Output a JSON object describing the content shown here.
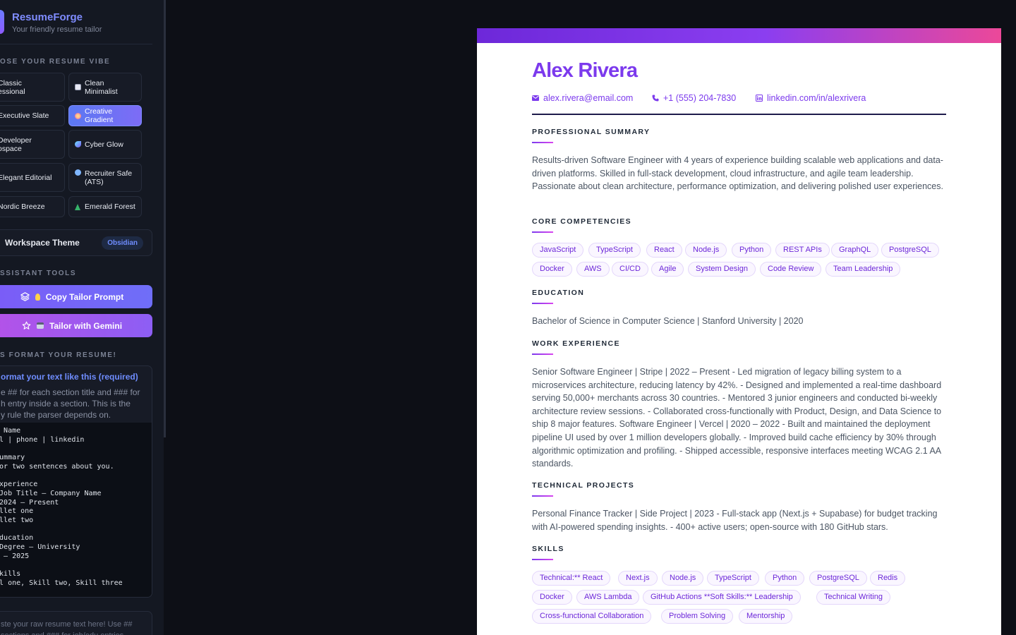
{
  "app": {
    "name": "ResumeForge",
    "tagline": "Your friendly resume tailor"
  },
  "sidebar": {
    "vibe_section": "OSE YOUR RESUME VIBE",
    "vibes": [
      {
        "label": "Classic\nessional",
        "icon": "none",
        "active": false
      },
      {
        "label": "Clean Minimalist",
        "icon": "square-icon",
        "active": false
      },
      {
        "label": "Executive Slate",
        "icon": "none",
        "active": false
      },
      {
        "label": "Creative Gradient",
        "icon": "palette-icon",
        "active": true
      },
      {
        "label": "Developer\nospace",
        "icon": "none",
        "active": false
      },
      {
        "label": "Cyber Glow",
        "icon": "comet-icon",
        "active": false
      },
      {
        "label": "Elegant Editorial",
        "icon": "none",
        "active": false
      },
      {
        "label": "Recruiter Safe\n(ATS)",
        "icon": "magnifier-icon",
        "active": false
      },
      {
        "label": "Nordic Breeze",
        "icon": "none",
        "active": false
      },
      {
        "label": "Emerald Forest",
        "icon": "tree-icon",
        "active": false
      }
    ],
    "theme": {
      "label": "Workspace Theme",
      "value": "Obsidian"
    },
    "tools_section": "SSISTANT TOOLS",
    "tools": {
      "copy_prompt": "Copy Tailor Prompt",
      "copy_prompt_icons": "layers-icon lightbulb-icon",
      "gemini": "Tailor with Gemini",
      "gemini_icons": "star-icon robot-icon"
    },
    "format_section": "S FORMAT YOUR RESUME!",
    "format": {
      "title": "ormat your text like this (required)",
      "description": "e ## for each section title and ### for\nh entry inside a section. This is the\ny rule the parser depends on.",
      "code": "ur Name\nail | phone | linkedin\n\n Summary\ne or two sentences about you.\n\n Experience\n# Job Title — Company Name\nn 2024 – Present\nBullet one\nBullet two\n\n Education\n# Degree — University\n21 – 2025\n\n Skills\nill one, Skill two, Skill three"
    },
    "paste_placeholder": "ste your raw resume text here! Use ##\nsections and ### for job/edu entries"
  },
  "resume": {
    "name": "Alex Rivera",
    "email": "alex.rivera@email.com",
    "phone": "+1 (555) 204-7830",
    "linkedin": "linkedin.com/in/alexrivera",
    "sections": {
      "summary_title": "PROFESSIONAL SUMMARY",
      "summary": "Results-driven Software Engineer with 4 years of experience building scalable web applications and data-driven platforms. Skilled in full-stack development, cloud infrastructure, and agile team leadership. Passionate about clean architecture, performance optimization, and delivering polished user experiences.",
      "competencies_title": "CORE COMPETENCIES",
      "competencies": [
        "JavaScript",
        "TypeScript",
        "React",
        "Node.js",
        "Python",
        "REST APIs",
        "GraphQL",
        "PostgreSQL",
        "Docker",
        "AWS",
        "CI/CD",
        "Agile",
        "System Design",
        "Code Review",
        "Team Leadership"
      ],
      "education_title": "EDUCATION",
      "education": "Bachelor of Science in Computer Science | Stanford University | 2020",
      "work_title": "WORK EXPERIENCE",
      "work": "Senior Software Engineer | Stripe | 2022 – Present - Led migration of legacy billing system to a microservices architecture, reducing latency by 42%. - Designed and implemented a real-time dashboard serving 50,000+ merchants across 30 countries. - Mentored 3 junior engineers and conducted bi-weekly architecture review sessions. - Collaborated cross-functionally with Product, Design, and Data Science to ship 8 major features. Software Engineer | Vercel | 2020 – 2022 - Built and maintained the deployment pipeline UI used by over 1 million developers globally. - Improved build cache efficiency by 30% through algorithmic optimization and profiling. - Shipped accessible, responsive interfaces meeting WCAG 2.1 AA standards.",
      "projects_title": "TECHNICAL PROJECTS",
      "projects": "Personal Finance Tracker | Side Project | 2023 - Full-stack app (Next.js + Supabase) for budget tracking with AI-powered spending insights. - 400+ active users; open-source with 180 GitHub stars.",
      "skills_title": "SKILLS",
      "skills": [
        "Technical:** React",
        "Next.js",
        "Node.js",
        "TypeScript",
        "Python",
        "PostgreSQL",
        "Redis",
        "Docker",
        "AWS Lambda",
        "GitHub Actions **Soft Skills:** Leadership",
        "Technical Writing",
        "Cross-functional Collaboration",
        "Problem Solving",
        "Mentorship"
      ]
    }
  },
  "colors": {
    "accent": "#7c3aed",
    "gradient_end": "#ec4899",
    "sidebar_bg": "#141822",
    "canvas_bg": "#0d0f16"
  }
}
